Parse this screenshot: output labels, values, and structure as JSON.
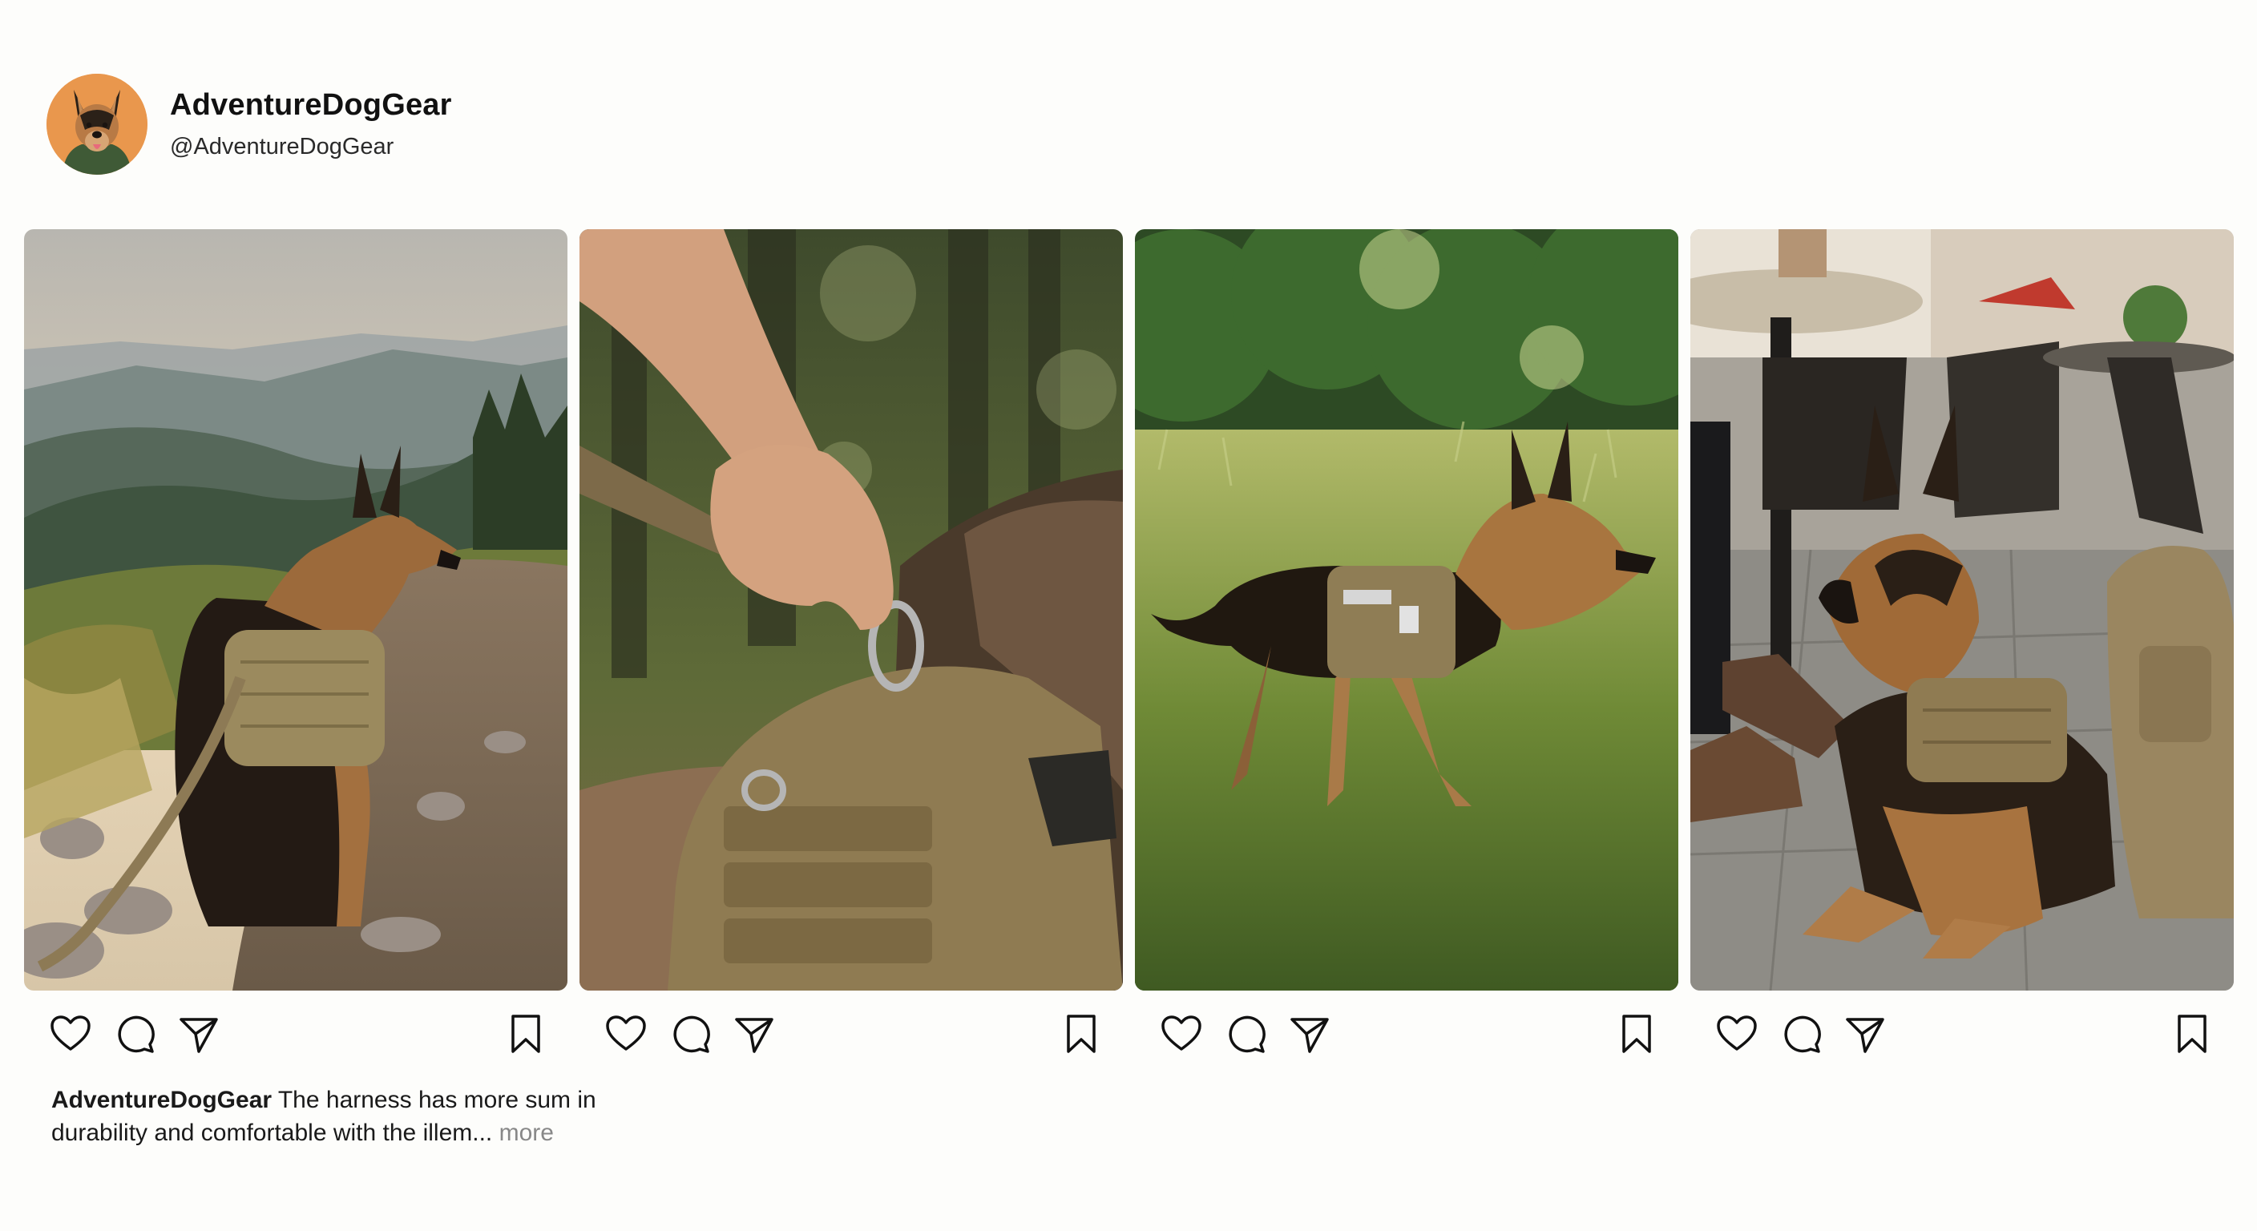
{
  "profile": {
    "username": "AdventureDogGear",
    "handle": "@AdventureDogGear",
    "avatar_icon": "german-shepherd-avatar",
    "avatar_bg": "#e9974d"
  },
  "posts": [
    {
      "photo": "dog-on-mountain-trail-photo"
    },
    {
      "photo": "hand-holding-leash-clip-photo"
    },
    {
      "photo": "dog-walking-in-meadow-photo"
    },
    {
      "photo": "dog-lying-at-cafe-photo"
    }
  ],
  "actions": {
    "like_icon": "heart-icon",
    "comment_icon": "comment-icon",
    "share_icon": "send-icon",
    "save_icon": "bookmark-icon"
  },
  "caption": {
    "user": "AdventureDogGear",
    "text": " The harness has more sum in durability and comfortable with the illem...",
    "more": " more"
  }
}
